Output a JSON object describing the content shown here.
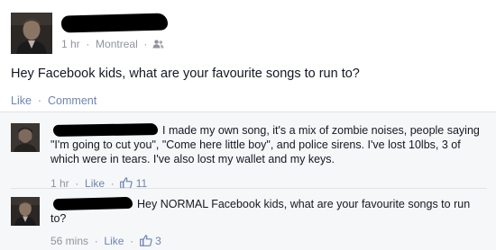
{
  "colors": {
    "link": "#6d84b4",
    "meta": "#90949c",
    "text": "#141823",
    "comments_bg": "#f6f7f8",
    "redaction": "#000000"
  },
  "post": {
    "time": "1 hr",
    "location": "Montreal",
    "audience_icon": "friends-icon",
    "text": "Hey Facebook kids, what are your favourite songs to run to?",
    "actions": {
      "like_label": "Like",
      "comment_label": "Comment"
    }
  },
  "comments": [
    {
      "text": "I made my own song, it's a mix of zombie noises, people saying \"I'm going to cut you\", \"Come here little boy\", and police sirens. I've lost 10lbs, 3 of which were in tears. I've also lost my wallet and my keys.",
      "time": "1 hr",
      "like_label": "Like",
      "like_icon": "thumbs-up-icon",
      "like_count": "11"
    },
    {
      "text": "Hey NORMAL Facebook kids, what are your favourite songs to run to?",
      "time": "56 mins",
      "like_label": "Like",
      "like_icon": "thumbs-up-icon",
      "like_count": "3"
    }
  ]
}
